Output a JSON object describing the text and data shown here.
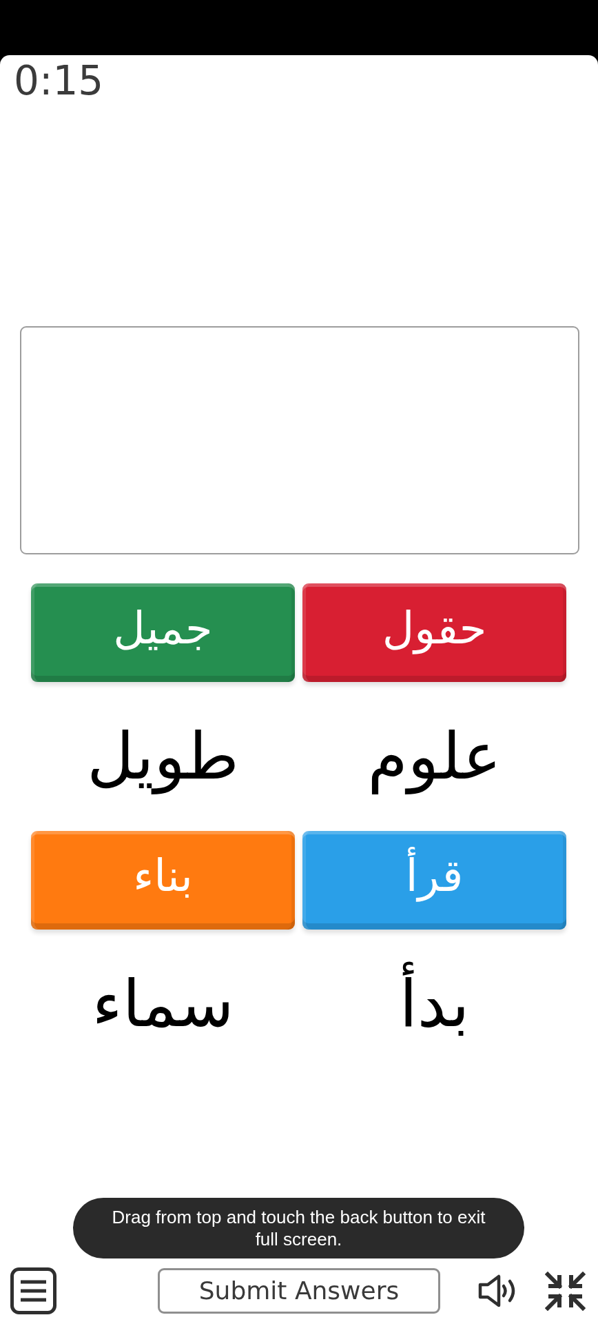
{
  "timer": "0:15",
  "tiles": [
    {
      "label": "حقول",
      "color": "#d81f32"
    },
    {
      "label": "جميل",
      "color": "#258f50"
    },
    {
      "label": "قرأ",
      "color": "#2a9fe8"
    },
    {
      "label": "بناء",
      "color": "#ff7a10"
    }
  ],
  "words": [
    "علوم",
    "طويل",
    "بدأ",
    "سماء"
  ],
  "toast": "Drag from top and touch the back button to exit full screen.",
  "submit_button": "Submit Answers"
}
